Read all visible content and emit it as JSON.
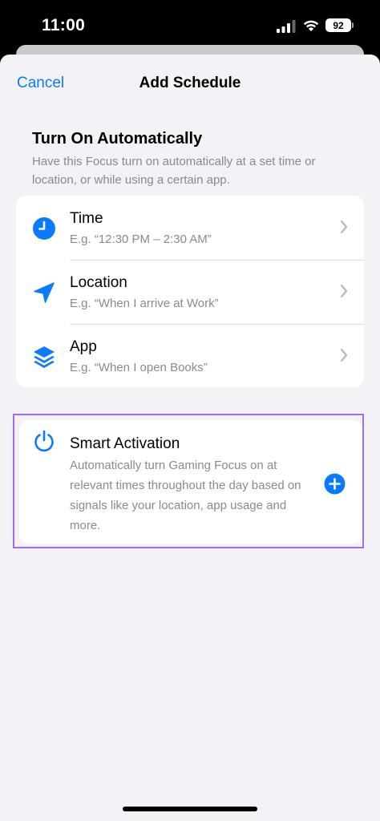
{
  "status_bar": {
    "time": "11:00",
    "battery": "92"
  },
  "nav": {
    "cancel_label": "Cancel",
    "title": "Add Schedule"
  },
  "section": {
    "heading": "Turn On Automatically",
    "description": "Have this Focus turn on automatically at a set time or location, or while using a certain app."
  },
  "options": [
    {
      "label": "Time",
      "sub": "E.g. “12:30 PM – 2:30 AM”",
      "icon": "clock-icon"
    },
    {
      "label": "Location",
      "sub": "E.g. “When I arrive at Work”",
      "icon": "location-arrow-icon"
    },
    {
      "label": "App",
      "sub": "E.g. “When I open Books”",
      "icon": "app-stack-icon"
    }
  ],
  "smart_activation": {
    "title": "Smart Activation",
    "description": "Automatically turn Gaming Focus on at relevant times throughout the day based on signals like your location, app usage and more.",
    "icon": "power-icon",
    "add_icon": "plus-circle-icon"
  },
  "colors": {
    "accent": "#0a7aff",
    "background": "#f2f2f7",
    "secondary_text": "#8a8a8e",
    "highlight_border": "#a36fe6"
  }
}
